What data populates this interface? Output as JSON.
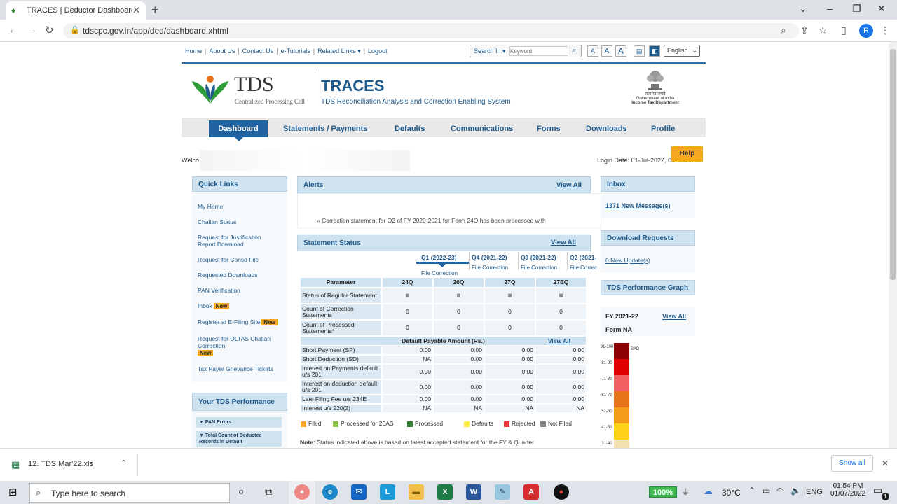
{
  "browser": {
    "tab_title": "TRACES | Deductor Dashboard",
    "url": "tdscpc.gov.in/app/ded/dashboard.xhtml",
    "avatar_initial": "R"
  },
  "toplinks": [
    "Home",
    "About Us",
    "Contact Us",
    "e-Tutorials",
    "Related Links ▾",
    "Logout"
  ],
  "search": {
    "label": "Search In ▾",
    "placeholder": "Keyword"
  },
  "font_sizes": [
    "A",
    "A",
    "A"
  ],
  "language": "English",
  "header": {
    "tds": "TDS",
    "tds_sub": "Centralized Processing Cell",
    "traces": "TRACES",
    "traces_sub": "TDS Reconciliation Analysis and Correction Enabling System",
    "gov_line1": "सत्यमेव जयते",
    "gov_line2": "Government of India",
    "gov_line3": "Income Tax Department"
  },
  "menu": [
    "Dashboard",
    "Statements / Payments",
    "Defaults",
    "Communications",
    "Forms",
    "Downloads",
    "Profile"
  ],
  "welcome": "Welco",
  "login_date": "Login Date: 01-Jul-2022, 01:50 PM",
  "help": "Help",
  "quick_links": {
    "title": "Quick Links",
    "items": [
      "My Home",
      "Challan Status",
      "Request for Justification Report Download",
      "Request for Conso File",
      "Requested Downloads",
      "PAN Verification",
      "Inbox",
      "Register at E-Filing Site",
      "Request for OLTAS Challan Correction",
      "Tax Payer Grievance Tickets"
    ],
    "new_badge": "New"
  },
  "tds_performance": {
    "title": "Your TDS Performance",
    "pan_errors": "▼ PAN Errors",
    "deductee": "▼ Total Count of Deductee Records in Default"
  },
  "alerts": {
    "title": "Alerts",
    "view_all": "View All",
    "line": "» Correction statement for Q2 of FY 2020-2021 for Form 24Q has been processed with"
  },
  "statement_status": {
    "title": "Statement Status",
    "view_all": "View All",
    "quarters": [
      "Q1 (2022-23)",
      "Q4 (2021-22)",
      "Q3 (2021-22)",
      "Q2 (2021-"
    ],
    "file_correction": "File Correction",
    "file_correction_short": "File Correc",
    "columns": [
      "Parameter",
      "24Q",
      "26Q",
      "27Q",
      "27EQ"
    ],
    "rows": [
      {
        "label": "Status of Regular Statement",
        "vals": [
          "■",
          "■",
          "■",
          "■"
        ]
      },
      {
        "label": "Count of Correction Statements",
        "vals": [
          "0",
          "0",
          "0",
          "0"
        ]
      },
      {
        "label": "Count of Processed Statements*",
        "vals": [
          "0",
          "0",
          "0",
          "0"
        ]
      }
    ],
    "default_header": "Default Payable Amount (Rs.)",
    "default_view_all": "View All",
    "default_rows": [
      {
        "label": "Short Payment (SP)",
        "vals": [
          "0.00",
          "0.00",
          "0.00",
          "0.00"
        ]
      },
      {
        "label": "Short Deduction (SD)",
        "vals": [
          "NA",
          "0.00",
          "0.00",
          "0.00"
        ]
      },
      {
        "label": "Interest on Payments default u/s 201",
        "vals": [
          "0.00",
          "0.00",
          "0.00",
          "0.00"
        ]
      },
      {
        "label": "Interest on deduction default u/s 201",
        "vals": [
          "0.00",
          "0.00",
          "0.00",
          "0.00"
        ]
      },
      {
        "label": "Late Filing Fee u/s 234E",
        "vals": [
          "0.00",
          "0.00",
          "0.00",
          "0.00"
        ]
      },
      {
        "label": "Interest u/s 220(2)",
        "vals": [
          "NA",
          "NA",
          "NA",
          "NA"
        ]
      }
    ],
    "legend": [
      {
        "label": "Filed",
        "color": "#f5a623"
      },
      {
        "label": "Processed for 26AS",
        "color": "#8bc34a"
      },
      {
        "label": "Processed",
        "color": "#2e7d32"
      },
      {
        "label": "Defaults",
        "color": "#ffeb3b"
      },
      {
        "label": "Rejected",
        "color": "#e53935"
      },
      {
        "label": "Not Filed",
        "color": "#888888"
      }
    ],
    "note_bold": "Note:",
    "note": "Status indicated above is based on latest accepted statement for the FY & Quarter"
  },
  "inbox": {
    "title": "Inbox",
    "messages": "1371 New Message(s)"
  },
  "download_requests": {
    "title": "Download Requests",
    "updates": "0 New Update(s)"
  },
  "perf_graph": {
    "title": "TDS Performance Graph",
    "fy": "FY 2021-22",
    "view_all": "View All",
    "form": "Form NA",
    "bands": [
      {
        "label": "91-100",
        "color": "#8b0000",
        "tag": "BAD"
      },
      {
        "label": "81-90",
        "color": "#e00000",
        "tag": ""
      },
      {
        "label": "71-80",
        "color": "#f06060",
        "tag": ""
      },
      {
        "label": "61-70",
        "color": "#e8731a",
        "tag": ""
      },
      {
        "label": "51-60",
        "color": "#f59c1a",
        "tag": ""
      },
      {
        "label": "41-50",
        "color": "#ffd21a",
        "tag": ""
      },
      {
        "label": "31-40",
        "color": "#f3e0b0",
        "tag": ""
      }
    ]
  },
  "download_shelf": {
    "file": "12. TDS Mar'22.xls",
    "show_all": "Show all"
  },
  "taskbar": {
    "search": "Type here to search",
    "battery": "100%",
    "temp": "30°C",
    "lang": "ENG",
    "time": "01:54 PM",
    "date": "01/07/2022",
    "notif": "1"
  }
}
